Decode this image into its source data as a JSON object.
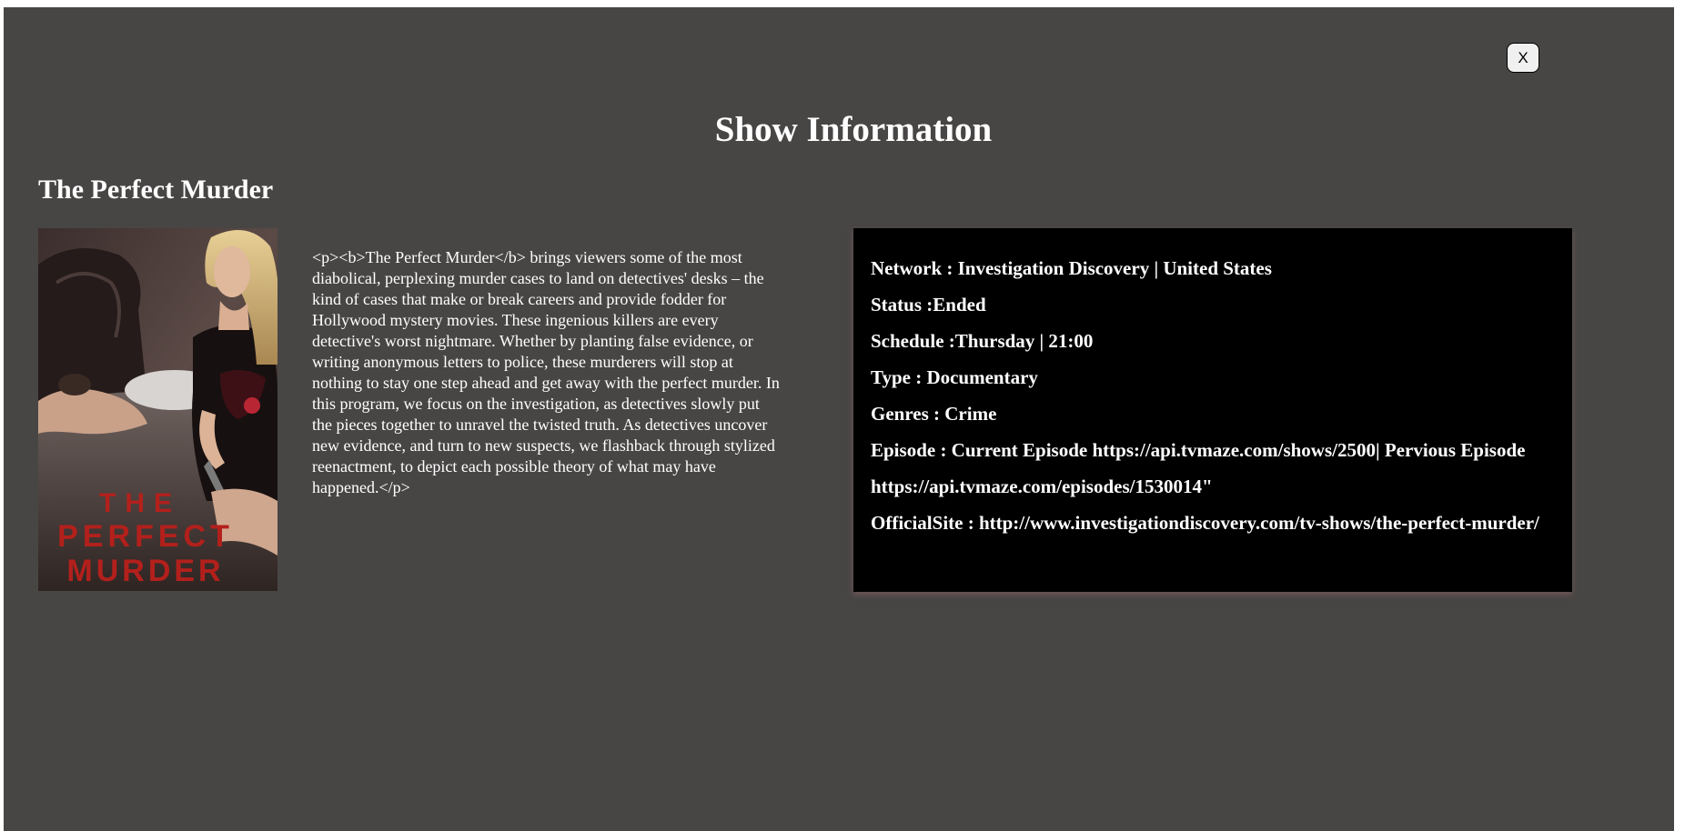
{
  "modal": {
    "close_label": "X",
    "title": "Show Information"
  },
  "show": {
    "name": "The Perfect Murder",
    "poster_text": [
      "THE",
      "PERFECT",
      "MURDER"
    ],
    "summary": "<p><b>The Perfect Murder</b> brings viewers some of the most diabolical, perplexing murder cases to land on detectives' desks – the kind of cases that make or break careers and provide fodder for Hollywood mystery movies. These ingenious killers are every detective's worst nightmare. Whether by planting false evidence, or writing anonymous letters to police, these murderers will stop at nothing to stay one step ahead and get away with the perfect murder. In this program, we focus on the investigation, as detectives slowly put the pieces together to unravel the twisted truth. As detectives uncover new evidence, and turn to new suspects, we flashback through stylized reenactment, to depict each possible theory of what may have happened.</p>"
  },
  "info": {
    "network": "Network : Investigation Discovery | United States",
    "status": "Status :Ended",
    "schedule": "Schedule :Thursday | 21:00",
    "type": "Type : Documentary",
    "genres": "Genres : Crime",
    "episode": "Episode : Current Episode https://api.tvmaze.com/shows/2500| Pervious Episode https://api.tvmaze.com/episodes/1530014\"",
    "official_site": "OfficialSite : http://www.investigationdiscovery.com/tv-shows/the-perfect-murder/"
  },
  "colors": {
    "modal_bg": "#484645",
    "panel_bg": "#000000",
    "poster_title_red": "#b3201c"
  }
}
